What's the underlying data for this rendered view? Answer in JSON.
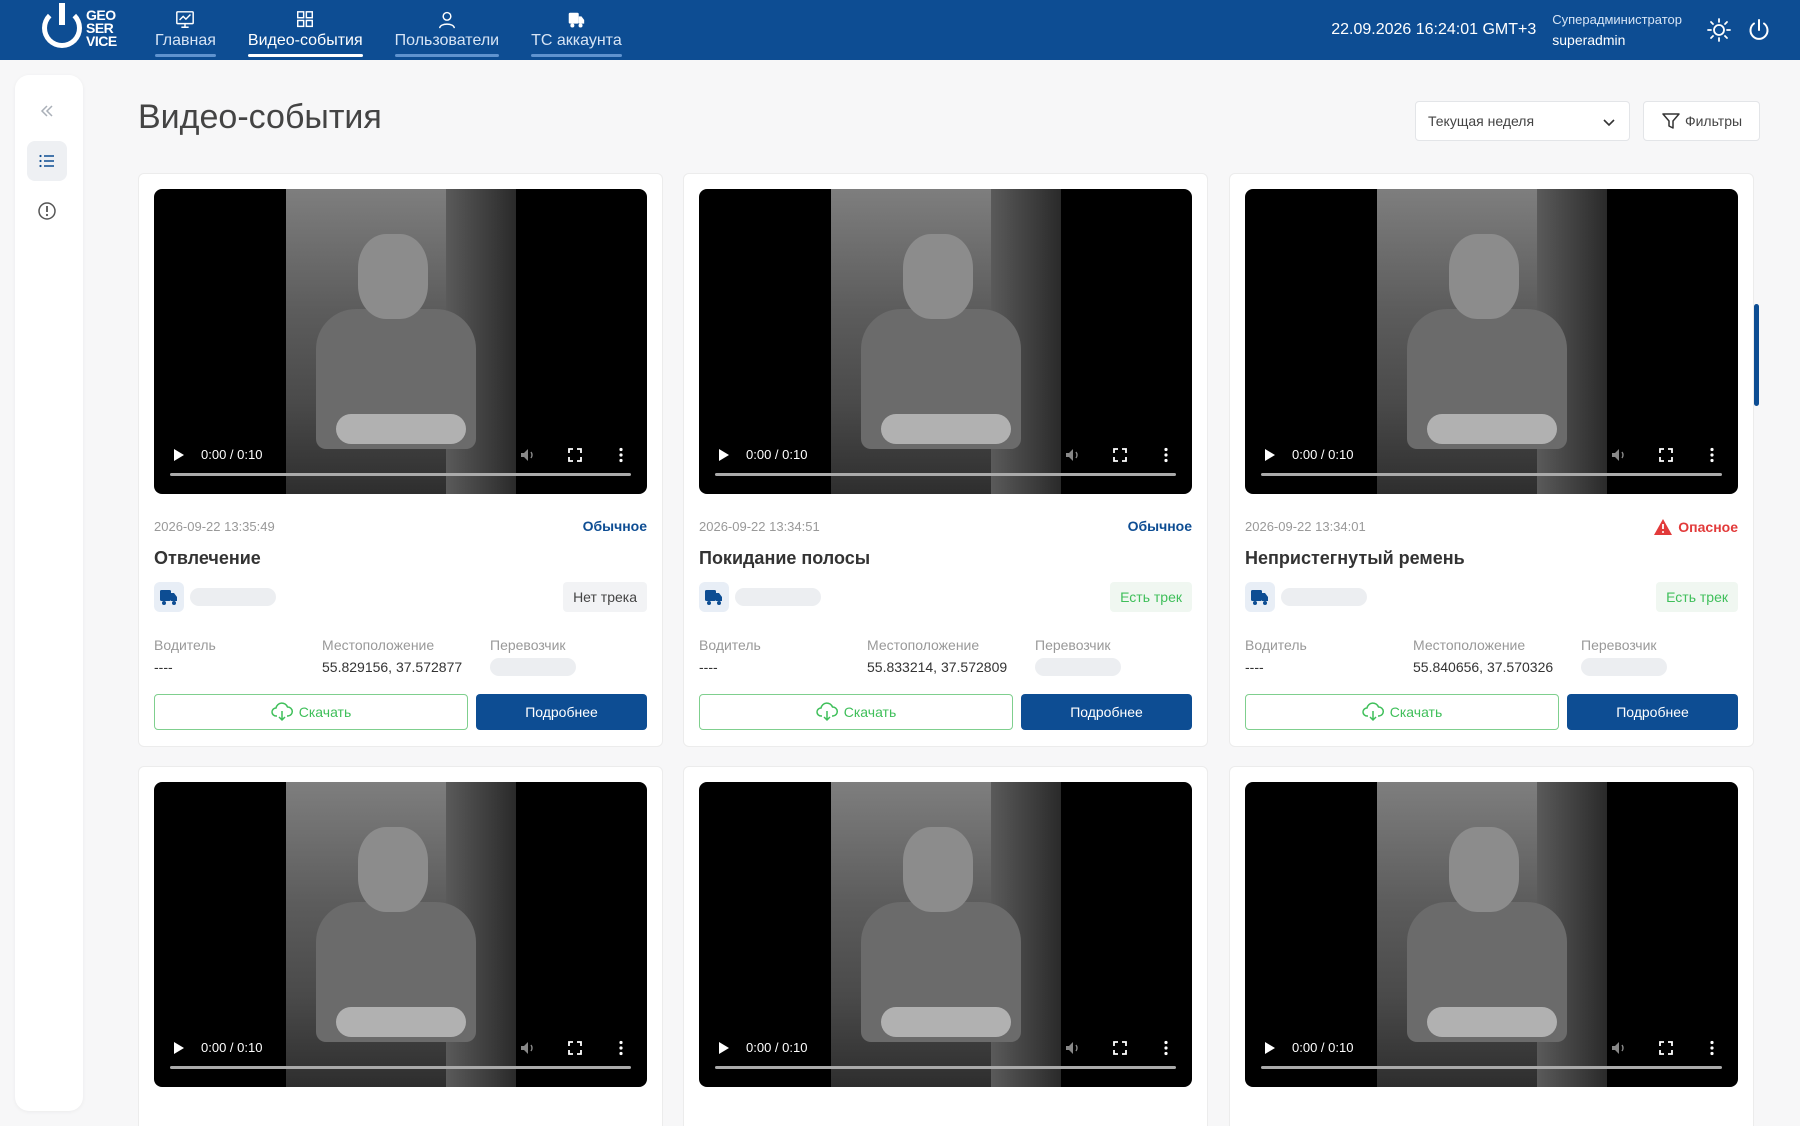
{
  "header": {
    "logo_text": [
      "GEO",
      "SER",
      "VICE"
    ],
    "nav": [
      {
        "label": "Главная",
        "icon": "monitor-icon",
        "active": false
      },
      {
        "label": "Видео-события",
        "icon": "grid-icon",
        "active": true
      },
      {
        "label": "Пользователи",
        "icon": "user-icon",
        "active": false
      },
      {
        "label": "ТС аккаунта",
        "icon": "truck-icon",
        "active": false
      }
    ],
    "datetime": "22.09.2026 16:24:01 GMT+3",
    "user_role": "Суперадминистратор",
    "user_login": "superadmin"
  },
  "page": {
    "title": "Видео-события",
    "period": "Текущая неделя",
    "filters_label": "Фильтры"
  },
  "labels": {
    "driver": "Водитель",
    "location": "Местоположение",
    "carrier": "Перевозчик",
    "download": "Скачать",
    "details": "Подробнее"
  },
  "cards": [
    {
      "time": "0:00 / 0:10",
      "date": "2026-09-22 13:35:49",
      "severity": "Обычное",
      "danger": false,
      "title": "Отвлечение",
      "track": "Нет трека",
      "has_track": false,
      "driver": "----",
      "location": "55.829156, 37.572877"
    },
    {
      "time": "0:00 / 0:10",
      "date": "2026-09-22 13:34:51",
      "severity": "Обычное",
      "danger": false,
      "title": "Покидание полосы",
      "track": "Есть трек",
      "has_track": true,
      "driver": "----",
      "location": "55.833214, 37.572809"
    },
    {
      "time": "0:00 / 0:10",
      "date": "2026-09-22 13:34:01",
      "severity": "Опасное",
      "danger": true,
      "title": "Непристегнутый ремень",
      "track": "Есть трек",
      "has_track": true,
      "driver": "----",
      "location": "55.840656, 37.570326"
    },
    {
      "time": "0:00 / 0:10"
    },
    {
      "time": "0:00 / 0:10"
    },
    {
      "time": "0:00 / 0:10"
    }
  ],
  "colors": {
    "primary": "#0d4d93",
    "success": "#3fbf5a",
    "danger": "#e23a3a"
  }
}
